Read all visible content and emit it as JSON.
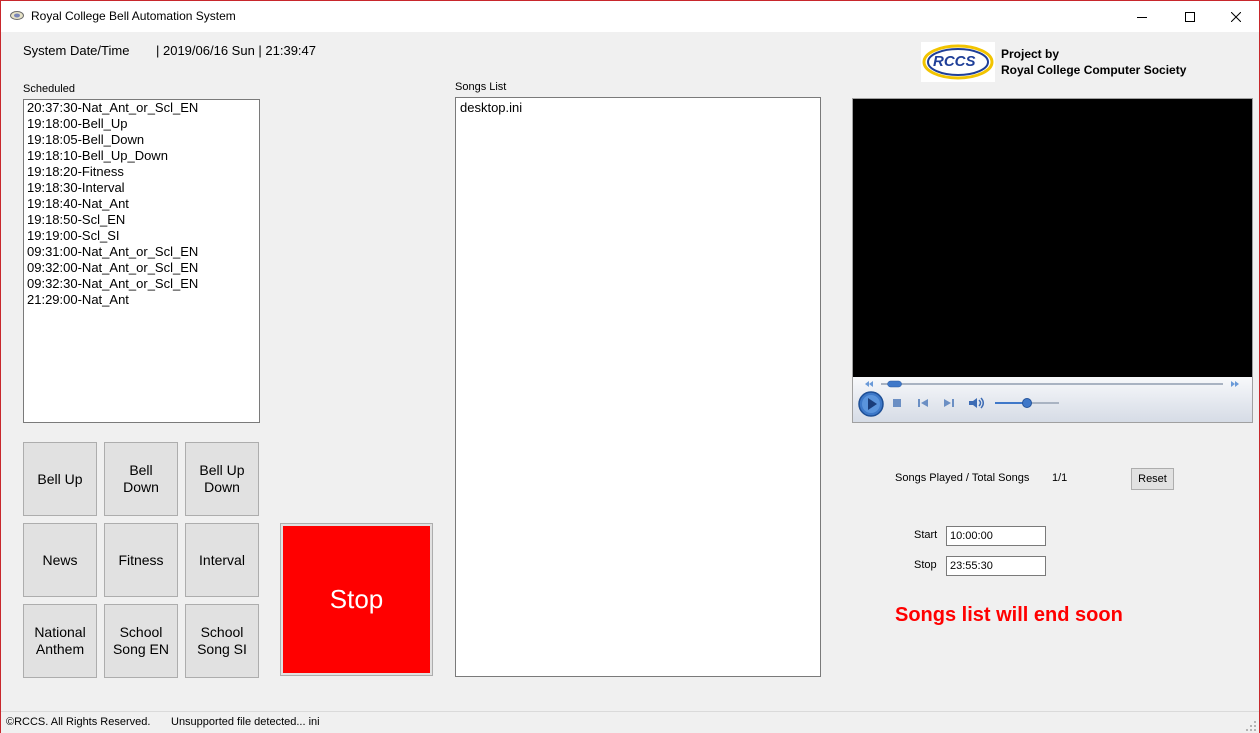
{
  "window": {
    "title": "Royal College Bell Automation System",
    "minimize_icon": "minimize-icon",
    "maximize_icon": "maximize-icon",
    "close_icon": "close-icon"
  },
  "header": {
    "datetime_label": "System Date/Time",
    "datetime_value": "| 2019/06/16 Sun | 21:39:47",
    "logo_text": "RCCS",
    "project_by": "Project by",
    "society": "Royal College Computer Society"
  },
  "scheduled": {
    "label": "Scheduled",
    "items": [
      "20:37:30-Nat_Ant_or_Scl_EN",
      "19:18:00-Bell_Up",
      "19:18:05-Bell_Down",
      "19:18:10-Bell_Up_Down",
      "19:18:20-Fitness",
      "19:18:30-Interval",
      "19:18:40-Nat_Ant",
      "19:18:50-Scl_EN",
      "19:19:00-Scl_SI",
      "09:31:00-Nat_Ant_or_Scl_EN",
      "09:32:00-Nat_Ant_or_Scl_EN",
      "09:32:30-Nat_Ant_or_Scl_EN",
      "21:29:00-Nat_Ant"
    ]
  },
  "buttons": {
    "bell_up": "Bell Up",
    "bell_down": "Bell\nDown",
    "bell_up_down": "Bell Up\nDown",
    "news": "News",
    "fitness": "Fitness",
    "interval": "Interval",
    "national_anthem": "National\nAnthem",
    "school_song_en": "School\nSong EN",
    "school_song_si": "School\nSong SI",
    "stop": "Stop"
  },
  "songs": {
    "label": "Songs List",
    "items": [
      "desktop.ini"
    ]
  },
  "player": {
    "seek_progress": 0.02,
    "volume": 0.5
  },
  "stats": {
    "songs_played_label": "Songs Played / Total Songs",
    "songs_played_value": "1/1",
    "reset_label": "Reset",
    "start_label": "Start",
    "start_value": "10:00:00",
    "stop_label": "Stop",
    "stop_value": "23:55:30",
    "warning": "Songs list will end soon",
    "warning_color": "#ff0000"
  },
  "status_bar": {
    "copyright": "©RCCS. All Rights Reserved.",
    "message": "Unsupported file detected... ini"
  }
}
